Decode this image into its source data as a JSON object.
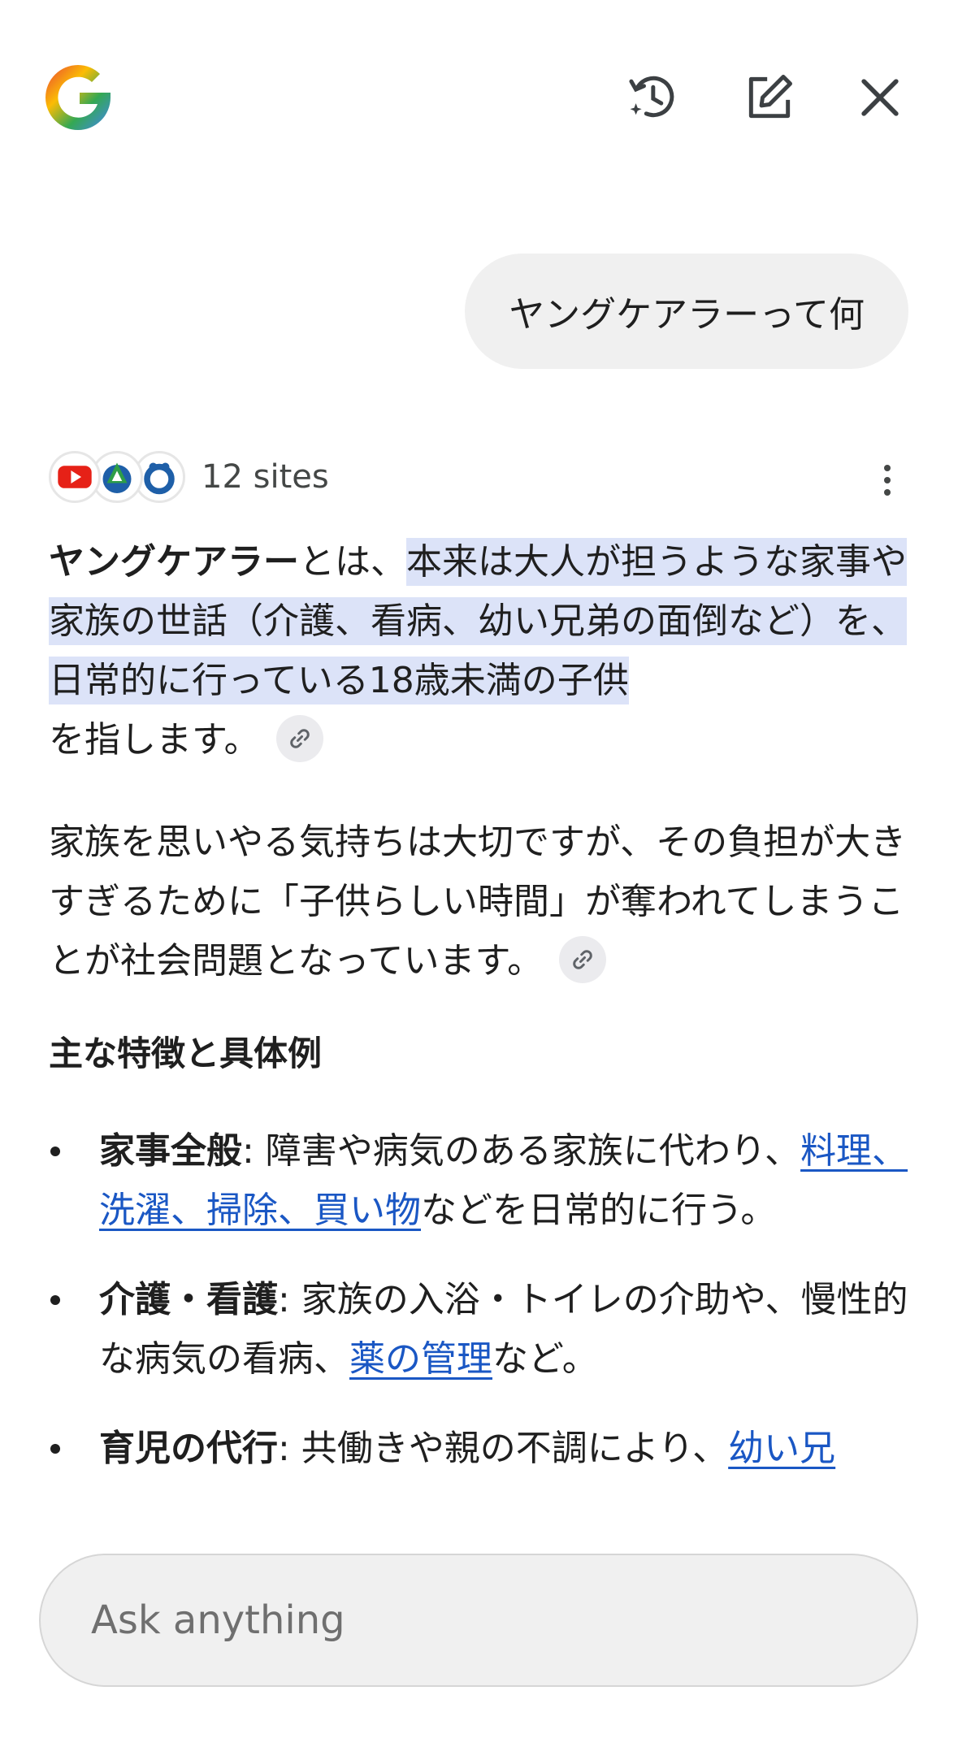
{
  "header": {
    "logo_icon": "google-g-logo",
    "history_icon": "history-sparkle-icon",
    "new_chat_icon": "edit-icon",
    "close_icon": "close-icon"
  },
  "user_message": "ヤングケアラーって何",
  "sources": {
    "count_label": "12 sites",
    "icons": [
      "youtube-icon",
      "site-logo-icon",
      "site-logo-icon"
    ],
    "more_icon": "more-vert-icon"
  },
  "answer": {
    "p1_term": "ヤングケアラー",
    "p1_after_term": "とは、",
    "p1_highlight": "本来は大人が担うような家事や家族の世話（介護、看病、幼い兄弟の面倒など）を、日常的に行っている18歳未満の子供",
    "p1_end": "を指します。",
    "p2": "家族を思いやる気持ちは大切ですが、その負担が大きすぎるために「子供らしい時間」が奪われてしまうことが社会問題となっています。",
    "heading": "主な特徴と具体例",
    "bullets": [
      {
        "title": "家事全般",
        "text_before": ": 障害や病気のある家族に代わり、",
        "link": "料理、洗濯、掃除、買い物",
        "text_after": "などを日常的に行う。"
      },
      {
        "title": "介護・看護",
        "text_before": ": 家族の入浴・トイレの介助や、慢性的な病気の看病、",
        "link": "薬の管理",
        "text_after": "など。"
      },
      {
        "title": "育児の代行",
        "text_before": ": 共働きや親の不調により、",
        "link": "幼い兄",
        "text_after": ""
      }
    ]
  },
  "input": {
    "placeholder": "Ask anything"
  },
  "colors": {
    "highlight": "#dce3f8",
    "link": "#1a57c4",
    "bubble": "#f0f0f0"
  }
}
